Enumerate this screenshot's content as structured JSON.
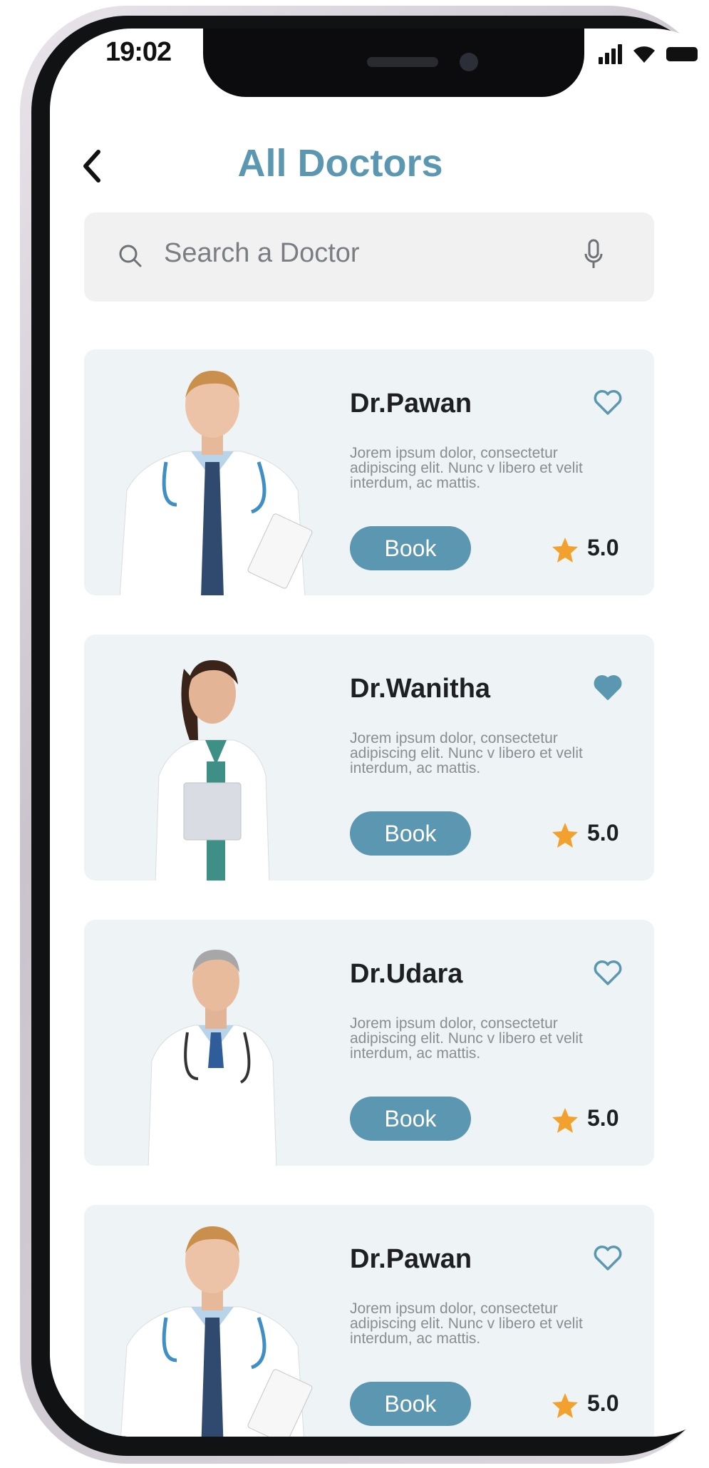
{
  "status_bar": {
    "time": "19:02"
  },
  "header": {
    "title": "All Doctors"
  },
  "search": {
    "placeholder": "Search a Doctor"
  },
  "colors": {
    "accent": "#5b97b1",
    "star": "#f1a12c",
    "card_bg": "#eef3f5"
  },
  "doctors": [
    {
      "name": "Dr.Pawan",
      "description": "Jorem ipsum dolor, consectetur adipiscing elit. Nunc v libero et velit interdum, ac  mattis.",
      "book_label": "Book",
      "rating": "5.0",
      "favorite": false
    },
    {
      "name": "Dr.Wanitha",
      "description": "Jorem ipsum dolor, consectetur adipiscing elit. Nunc v libero et velit interdum, ac  mattis.",
      "book_label": "Book",
      "rating": "5.0",
      "favorite": true
    },
    {
      "name": "Dr.Udara",
      "description": "Jorem ipsum dolor, consectetur adipiscing elit. Nunc v libero et velit interdum, ac  mattis.",
      "book_label": "Book",
      "rating": "5.0",
      "favorite": false
    },
    {
      "name": "Dr.Pawan",
      "description": "Jorem ipsum dolor, consectetur adipiscing elit. Nunc v libero et velit interdum, ac  mattis.",
      "book_label": "Book",
      "rating": "5.0",
      "favorite": false
    }
  ]
}
